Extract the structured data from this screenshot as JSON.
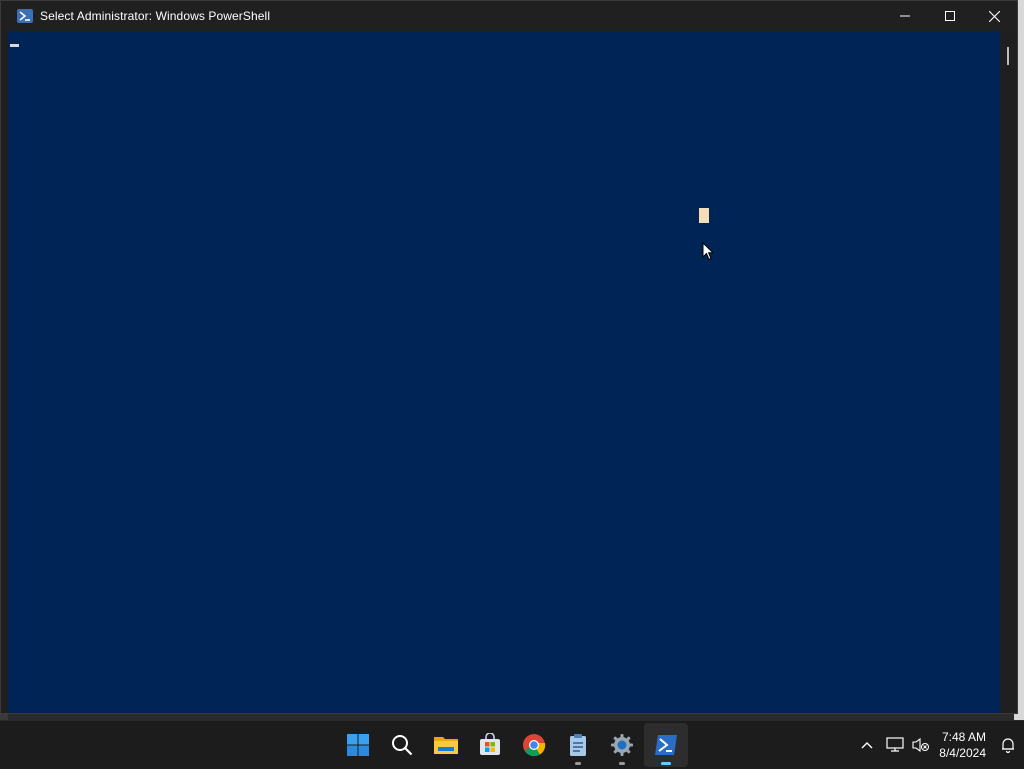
{
  "window": {
    "title": "Select Administrator: Windows PowerShell",
    "icon": "powershell-icon",
    "controls": [
      "minimize-icon",
      "maximize-icon",
      "close-icon"
    ]
  },
  "console": {
    "background_color": "#012456",
    "cursor_color": "#d8d8d8",
    "selection_color": "#f5deb3"
  },
  "taskbar": {
    "apps": [
      {
        "name": "start",
        "icon": "windows-logo-icon",
        "active": false,
        "running": false
      },
      {
        "name": "search",
        "icon": "search-icon",
        "active": false,
        "running": false
      },
      {
        "name": "file-explorer",
        "icon": "folder-icon",
        "active": false,
        "running": false
      },
      {
        "name": "microsoft-store",
        "icon": "store-icon",
        "active": false,
        "running": false
      },
      {
        "name": "chrome",
        "icon": "chrome-icon",
        "active": false,
        "running": false
      },
      {
        "name": "notepad-app",
        "icon": "clipboard-icon",
        "active": false,
        "running": true
      },
      {
        "name": "settings",
        "icon": "gear-icon",
        "active": false,
        "running": true
      },
      {
        "name": "powershell",
        "icon": "powershell-icon",
        "active": true,
        "running": true
      }
    ],
    "tray": {
      "overflow_icon": "chevron-up-icon",
      "network_icon": "network-icon",
      "volume_icon": "volume-muted-icon",
      "time": "7:48 AM",
      "date": "8/4/2024",
      "notification_icon": "bell-icon"
    }
  }
}
